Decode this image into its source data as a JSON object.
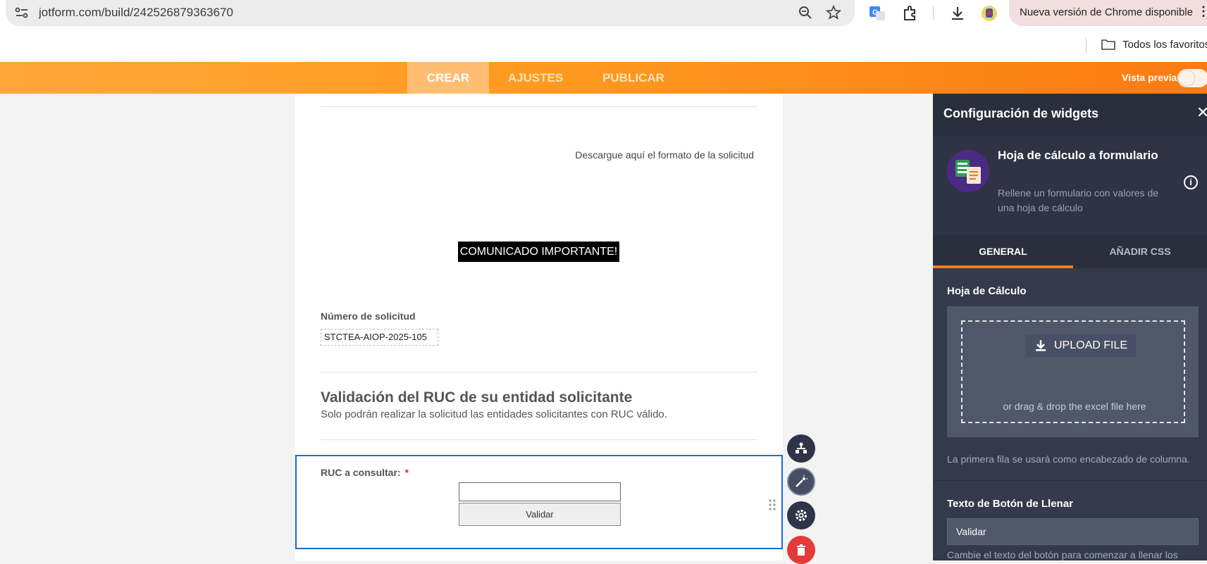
{
  "browser": {
    "url": "jotform.com/build/242526879363670",
    "update_label": "Nueva versión de Chrome disponible",
    "bookmark_folder": "Todos los favoritos"
  },
  "jotform": {
    "tabs": [
      {
        "label": "CREAR",
        "active": true
      },
      {
        "label": "AJUSTES",
        "active": false
      },
      {
        "label": "PUBLICAR",
        "active": false
      }
    ],
    "preview_label": "Vista previa",
    "accent": "#fa7c1c"
  },
  "form": {
    "download_text": "Descargue aquí el formato de la solicitud",
    "notice_text": "COMUNICADO IMPORTANTE!",
    "request_number_label": "Número de solicitud",
    "request_number_value": "STCTEA-AIOP-2025-105",
    "section_title": "Validación del RUC de su entidad solicitante",
    "section_subtitle": "Solo podrán realizar la solicitud las entidades solicitantes con RUC válido.",
    "ruc_label": "RUC a consultar:",
    "required_mark": "*",
    "ruc_input_value": "",
    "validate_button": "Validar"
  },
  "panel": {
    "title": "Configuración de widgets",
    "close": "✕",
    "widget_name": "Hoja de cálculo a formulario",
    "widget_desc": "Rellene un formulario con valores de una hoja de cálculo",
    "info": "i",
    "tabs": [
      "GENERAL",
      "AÑADIR CSS"
    ],
    "sheet_label": "Hoja de Cálculo",
    "upload_button": "UPLOAD FILE",
    "drop_text": "or drag & drop the excel file here",
    "first_row_hint": "La primera fila se usará como encabezado de columna.",
    "fill_button_label": "Texto de Botón de Llenar",
    "fill_button_value": "Validar",
    "fill_button_hint": "Cambie el texto del botón para comenzar a llenar los"
  }
}
